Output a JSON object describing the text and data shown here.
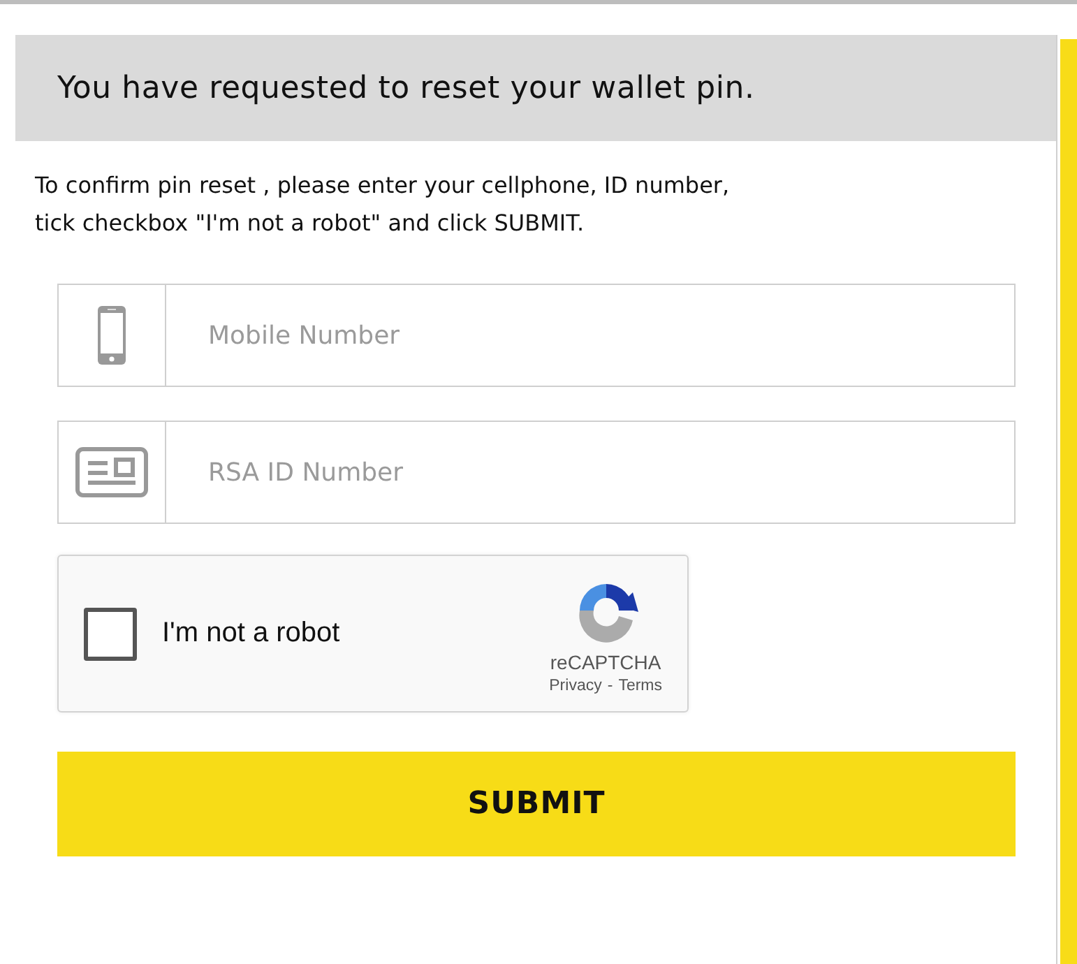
{
  "header": {
    "title": "You have requested to reset your wallet pin."
  },
  "instructions": [
    "To confirm pin reset , please enter your cellphone, ID number,",
    "tick checkbox \"I'm not a robot\" and click SUBMIT."
  ],
  "fields": [
    {
      "kind": "phone",
      "placeholder": "Mobile Number"
    },
    {
      "kind": "id-card",
      "placeholder": "RSA ID Number"
    }
  ],
  "captcha": {
    "label": "I'm not a robot",
    "checked": false,
    "brand": "reCAPTCHA",
    "privacy": "Privacy",
    "separator": "-",
    "terms": "Terms"
  },
  "submit": {
    "label": "SUBMIT"
  }
}
